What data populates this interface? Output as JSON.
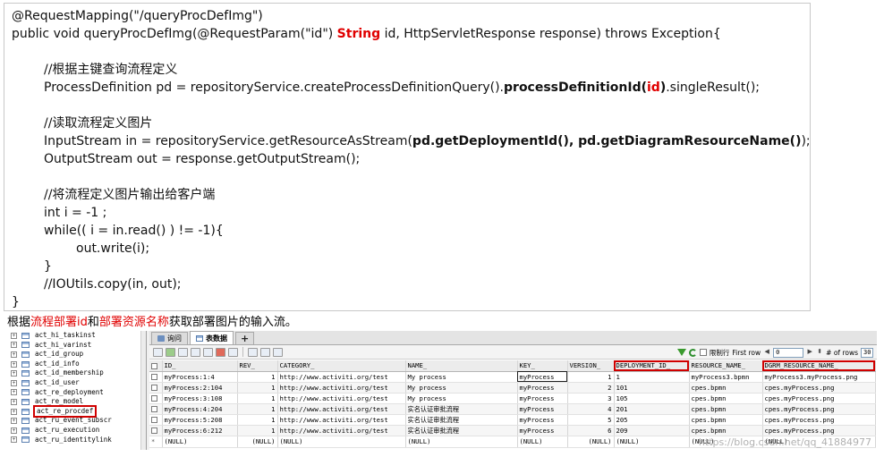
{
  "code": {
    "line1": "@RequestMapping(\"/queryProcDefImg\")",
    "line2_a": "public void queryProcDefImg(@RequestParam(\"id\") ",
    "line2_kw": "String",
    "line2_b": " id, HttpServletResponse response) throws Exception{",
    "comment1": "//根据主键查询流程定义",
    "line4_a": "ProcessDefinition pd = repositoryService.createProcessDefinitionQuery().",
    "line4_b": "processDefinitionId(",
    "line4_kw": "id",
    "line4_c": ")",
    "line4_d": ".singleResult();",
    "comment2": "//读取流程定义图片",
    "line6_a": "InputStream in = repositoryService.getResourceAsStream(",
    "line6_b": "pd.getDeploymentId(), pd.getDiagramResourceName()",
    "line6_c": ");",
    "line7": "OutputStream out = response.getOutputStream();",
    "comment3": "//将流程定义图片输出给客户端",
    "line9": "int i = -1 ;",
    "line10": "while(( i = in.read() ) != -1){",
    "line11": "out.write(i);",
    "line12": "}",
    "line13": "//IOUtils.copy(in, out);",
    "line14": "}"
  },
  "caption": {
    "part1": "根据",
    "hl1": "流程部署id",
    "part2": "和",
    "hl2": "部署资源名称",
    "part3": "获取部署图片的输入流。"
  },
  "tree": {
    "items": [
      "act_hi_taskinst",
      "act_hi_varinst",
      "act_id_group",
      "act_id_info",
      "act_id_membership",
      "act_id_user",
      "act_re_deployment",
      "act_re_model",
      "act_re_procdef",
      "act_ru_event_subscr",
      "act_ru_execution",
      "act_ru_identitylink"
    ],
    "selected": "act_re_procdef",
    "expander": "+"
  },
  "tabs": {
    "query": "询问",
    "table": "表数据",
    "add": "+"
  },
  "toolbar": {
    "limit_label": "限制行",
    "first_row_label": "First row",
    "first_row_value": "0",
    "rows_label": "# of rows",
    "rows_value": "30",
    "prev": "◀",
    "next": "▶",
    "updown": "⬍"
  },
  "grid": {
    "columns": [
      "ID_",
      "REV_",
      "CATEGORY_",
      "NAME_",
      "KEY_",
      "VERSION_",
      "DEPLOYMENT_ID_",
      "RESOURCE_NAME_",
      "DGRM_RESOURCE_NAME_"
    ],
    "rows": [
      [
        "myProcess:1:4",
        "1",
        "http://www.activiti.org/test",
        "My process",
        "myProcess",
        "1",
        "1",
        "myProcess3.bpmn",
        "myProcess3.myProcess.png"
      ],
      [
        "myProcess:2:104",
        "1",
        "http://www.activiti.org/test",
        "My process",
        "myProcess",
        "2",
        "101",
        "cpes.bpmn",
        "cpes.myProcess.png"
      ],
      [
        "myProcess:3:108",
        "1",
        "http://www.activiti.org/test",
        "My process",
        "myProcess",
        "3",
        "105",
        "cpes.bpmn",
        "cpes.myProcess.png"
      ],
      [
        "myProcess:4:204",
        "1",
        "http://www.activiti.org/test",
        "实名认证审批流程",
        "myProcess",
        "4",
        "201",
        "cpes.bpmn",
        "cpes.myProcess.png"
      ],
      [
        "myProcess:5:208",
        "1",
        "http://www.activiti.org/test",
        "实名认证审批流程",
        "myProcess",
        "5",
        "205",
        "cpes.bpmn",
        "cpes.myProcess.png"
      ],
      [
        "myProcess:6:212",
        "1",
        "http://www.activiti.org/test",
        "实名认证审批流程",
        "myProcess",
        "6",
        "209",
        "cpes.bpmn",
        "cpes.myProcess.png"
      ]
    ],
    "null_row": [
      "(NULL)",
      "(NULL)",
      "(NULL)",
      "(NULL)",
      "(NULL)",
      "(NULL)",
      "(NULL)",
      "(NULL)",
      "(NULL)"
    ],
    "new_row_marker": "*"
  },
  "watermark": "https://blog.csdn.net/qq_41884977"
}
